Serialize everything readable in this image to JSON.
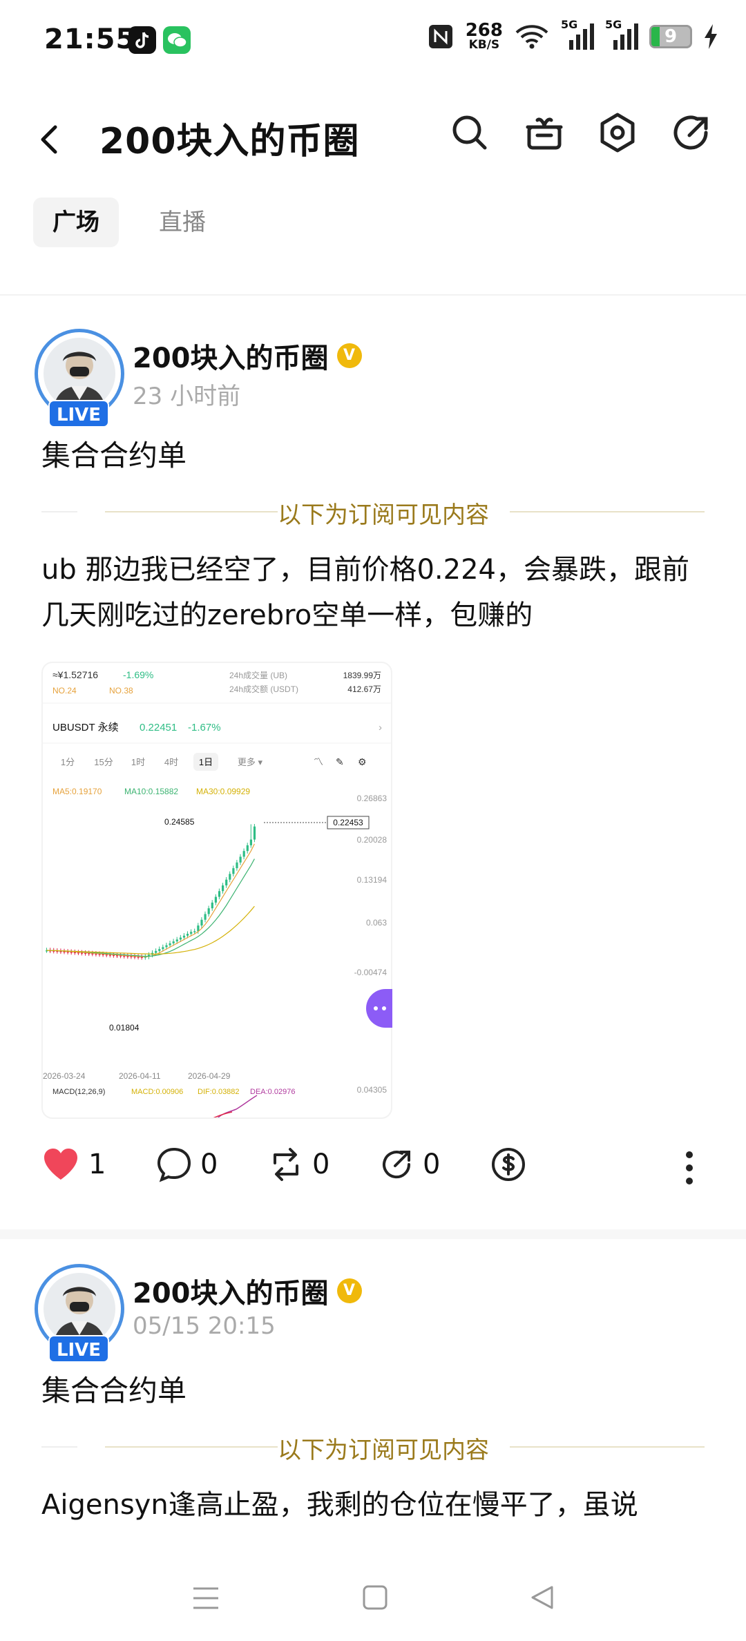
{
  "status": {
    "time": "21:55",
    "speed_value": "268",
    "speed_unit": "KB/S",
    "net1": "5G",
    "net2": "5G",
    "battery": "9"
  },
  "header": {
    "title": "200块入的币圈"
  },
  "tabs": [
    {
      "label": "广场"
    },
    {
      "label": "直播"
    }
  ],
  "posts": [
    {
      "author": "200块入的币圈",
      "live": "LIVE",
      "time": "23 小时前",
      "title": "集合合约单",
      "subscribe_text": "以下为订阅可见内容",
      "body": "ub  那边我已经空了，目前价格0.224，会暴跌，跟前几天刚吃过的zerebro空单一样，包赚的",
      "actions": {
        "likes": "1",
        "comments": "0",
        "reposts": "0",
        "shares": "0"
      }
    },
    {
      "author": "200块入的币圈",
      "live": "LIVE",
      "time": "05/15 20:15",
      "title": "集合合约单",
      "subscribe_text": "以下为订阅可见内容",
      "body": "Aigensyn逢高止盈，我剩的仓位在慢平了，虽说"
    }
  ],
  "chart": {
    "price_top": "≈¥1.52716",
    "change_top": "-1.69%",
    "no1": "NO.24",
    "no2": "NO.38",
    "stat_rows": [
      {
        "label": "24h成交量 (UB)",
        "value": "1839.99万"
      },
      {
        "label": "24h成交额 (USDT)",
        "value": "412.67万"
      }
    ],
    "symbol": "UBUSDT 永续",
    "price": "0.22451",
    "change": "-1.67%",
    "intervals": [
      "1分",
      "15分",
      "1时",
      "4时",
      "1日",
      "更多"
    ],
    "ma_labels": [
      "MA5:0.19170",
      "MA10:0.15882",
      "MA30:0.09929"
    ],
    "axis_ticks": [
      "0.26863",
      "0.20028",
      "0.13194",
      "0.063",
      "-0.00474",
      "0.04305"
    ],
    "current_price_tag": "0.22453",
    "high_label": "0.24585",
    "low_label": "0.01804",
    "dates": [
      "2026-03-24",
      "2026-04-11",
      "2026-04-29"
    ],
    "macd_labels": [
      "MACD(12,26,9)",
      "MACD:0.00906",
      "DIF:0.03882",
      "DEA:0.02976"
    ],
    "chart_data": {
      "type": "candlestick",
      "x": [
        "2026-03-24",
        "2026-04-11",
        "2026-04-29"
      ],
      "high": 0.24585,
      "low": 0.01804,
      "last": 0.22453
    },
    "colors": {
      "up": "#2ebd85",
      "down": "#e0294a",
      "ma5": "#e6a23c",
      "ma10": "#3cb371",
      "ma30": "#d4b106"
    }
  }
}
